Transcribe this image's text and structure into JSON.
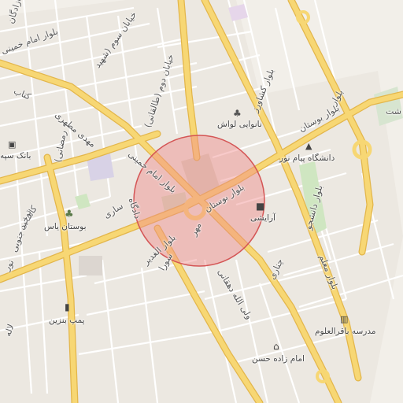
{
  "map": {
    "colors": {
      "background": "#f2efe9",
      "major_road": "#f7d774",
      "major_road_casing": "#e3b64b",
      "minor_road": "#ffffff",
      "park": "#cfe6c1",
      "highlight_fill": "#f08a8a",
      "highlight_stroke": "#d45555"
    },
    "roads": [
      {
        "name": "road-azadegan",
        "text": "آزادگان"
      },
      {
        "name": "road-khiaban-sevvom-shahid",
        "text": "خیابان سوم (شهید"
      },
      {
        "name": "road-bolvar-emam-khomeini-nw",
        "text": "بلوار امام خمینی"
      },
      {
        "name": "road-ketab",
        "text": "کتاب"
      },
      {
        "name": "road-mahdi-motahhari",
        "text": "مهدی مطهری"
      },
      {
        "name": "road-khiaban-dovvom-taleghani",
        "text": "خیابان دوم (طالقانی)"
      },
      {
        "name": "road-ramazani",
        "text": "(رمضانی"
      },
      {
        "name": "road-bolvar-emam-khomeini",
        "text": "بلوار امام خمینی"
      },
      {
        "name": "road-bolvar-boostan",
        "text": "بلوار بوستان"
      },
      {
        "name": "road-bolvar-keshavarz",
        "text": "بلوار کشاورز"
      },
      {
        "name": "road-bolvar-boostan-ne",
        "text": "بلوار بوستان"
      },
      {
        "name": "road-bolvar-daneshjoo",
        "text": "بلوار دانشجو"
      },
      {
        "name": "road-dadgah",
        "text": "دادگاه"
      },
      {
        "name": "road-sari",
        "text": "ساری"
      },
      {
        "name": "road-kashani",
        "text": "کاشانی"
      },
      {
        "name": "road-bolvar-alghadir",
        "text": "بلوار الغدیر"
      },
      {
        "name": "road-mehr",
        "text": "مهر"
      },
      {
        "name": "road-soura",
        "text": "سورا"
      },
      {
        "name": "road-vali-allah-dehghani",
        "text": "ولی الله دهقانی"
      },
      {
        "name": "road-chenari",
        "text": "چناری"
      },
      {
        "name": "road-bolvar-moallem",
        "text": "بلوار معلم"
      },
      {
        "name": "road-tohid-jonubi",
        "text": "توحید جنوبی"
      },
      {
        "name": "road-bolvar-edge",
        "text": "بلوار"
      },
      {
        "name": "road-laleh-edge",
        "text": "لاله"
      },
      {
        "name": "road-noor-edge",
        "text": "نور"
      },
      {
        "name": "road-sht-edge",
        "text": "شت"
      }
    ],
    "pois": [
      {
        "name": "poi-nanvaei-lavash",
        "text": "نانوایی لواش",
        "icon": "bakery-icon",
        "glyph": "♣"
      },
      {
        "name": "poi-daneshgah-payam-noor",
        "text": "دانشگاه پیام نور",
        "icon": "university-icon",
        "glyph": "🎓"
      },
      {
        "name": "poi-bank-sepah",
        "text": "بانک سپه",
        "icon": "bank-icon",
        "glyph": "▣"
      },
      {
        "name": "poi-boostan-yas",
        "text": "بوستان یاس",
        "icon": "park-tree-icon",
        "glyph": "♣"
      },
      {
        "name": "poi-arayeshi",
        "text": "آرایشی",
        "icon": "cosmetics-shop-icon",
        "glyph": "🛍"
      },
      {
        "name": "poi-pomp-benzin",
        "text": "پمپ بنزین",
        "icon": "fuel-station-icon",
        "glyph": "⛽"
      },
      {
        "name": "poi-madrese-bagher-olulum",
        "text": "مدرسه باقرالعلوم",
        "icon": "school-icon",
        "glyph": "▥"
      },
      {
        "name": "poi-emamzadeh-hasan",
        "text": "امام زاده حسن",
        "icon": "shrine-icon",
        "glyph": "⌂"
      }
    ]
  }
}
